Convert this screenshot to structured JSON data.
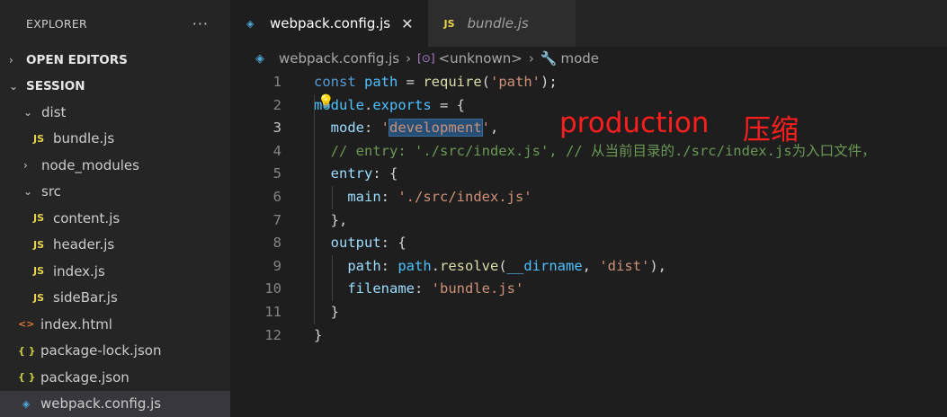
{
  "sidebar": {
    "title": "EXPLORER",
    "more": "···",
    "open_editors": "OPEN EDITORS",
    "session": "SESSION",
    "tree": [
      {
        "label": "dist",
        "kind": "folder-open",
        "depth": 1
      },
      {
        "label": "bundle.js",
        "kind": "js",
        "depth": 2
      },
      {
        "label": "node_modules",
        "kind": "folder-closed",
        "depth": 1
      },
      {
        "label": "src",
        "kind": "folder-open",
        "depth": 1
      },
      {
        "label": "content.js",
        "kind": "js",
        "depth": 2
      },
      {
        "label": "header.js",
        "kind": "js",
        "depth": 2
      },
      {
        "label": "index.js",
        "kind": "js",
        "depth": 2
      },
      {
        "label": "sideBar.js",
        "kind": "js",
        "depth": 2
      },
      {
        "label": "index.html",
        "kind": "html",
        "depth": 1
      },
      {
        "label": "package-lock.json",
        "kind": "json",
        "depth": 1
      },
      {
        "label": "package.json",
        "kind": "json",
        "depth": 1
      },
      {
        "label": "webpack.config.js",
        "kind": "webpack",
        "depth": 1,
        "selected": true
      }
    ]
  },
  "icons": {
    "js": "JS",
    "html": "<>",
    "json": "{ }",
    "webpack": "◈",
    "chevron_right": "›",
    "chevron_down": "⌄"
  },
  "tabs": [
    {
      "label": "webpack.config.js",
      "active": true,
      "close": "✕"
    },
    {
      "label": "bundle.js",
      "active": false
    }
  ],
  "breadcrumb": {
    "file": "webpack.config.js",
    "sep": "›",
    "symbol1": "<unknown>",
    "symbol2": "mode"
  },
  "editor": {
    "lines": [
      {
        "n": "1",
        "tokens": [
          [
            "kw",
            "const "
          ],
          [
            "var",
            "path"
          ],
          [
            "def",
            " = "
          ],
          [
            "fn",
            "require"
          ],
          [
            "def",
            "("
          ],
          [
            "str",
            "'path'"
          ],
          [
            "def",
            ");"
          ]
        ]
      },
      {
        "n": "2",
        "tokens": [
          [
            "var",
            "module"
          ],
          [
            "def",
            "."
          ],
          [
            "var",
            "exports"
          ],
          [
            "def",
            " = {"
          ]
        ]
      },
      {
        "n": "3",
        "tokens": [
          [
            "def",
            "  "
          ],
          [
            "prop",
            "mode"
          ],
          [
            "def",
            ": "
          ],
          [
            "str",
            "'"
          ],
          [
            "strsel",
            "development"
          ],
          [
            "str",
            "'"
          ],
          [
            "def",
            ","
          ]
        ],
        "current": true
      },
      {
        "n": "4",
        "tokens": [
          [
            "def",
            "  "
          ],
          [
            "com",
            "// entry: './src/index.js', // 从当前目录的./src/index.js为入口文件，"
          ]
        ]
      },
      {
        "n": "5",
        "tokens": [
          [
            "def",
            "  "
          ],
          [
            "prop",
            "entry"
          ],
          [
            "def",
            ": {"
          ]
        ]
      },
      {
        "n": "6",
        "tokens": [
          [
            "def",
            "    "
          ],
          [
            "prop",
            "main"
          ],
          [
            "def",
            ": "
          ],
          [
            "str",
            "'./src/index.js'"
          ]
        ]
      },
      {
        "n": "7",
        "tokens": [
          [
            "def",
            "  },"
          ]
        ]
      },
      {
        "n": "8",
        "tokens": [
          [
            "def",
            "  "
          ],
          [
            "prop",
            "output"
          ],
          [
            "def",
            ": {"
          ]
        ]
      },
      {
        "n": "9",
        "tokens": [
          [
            "def",
            "    "
          ],
          [
            "prop",
            "path"
          ],
          [
            "def",
            ": "
          ],
          [
            "var",
            "path"
          ],
          [
            "def",
            "."
          ],
          [
            "fn",
            "resolve"
          ],
          [
            "def",
            "("
          ],
          [
            "var",
            "__dirname"
          ],
          [
            "def",
            ", "
          ],
          [
            "str",
            "'dist'"
          ],
          [
            "def",
            "),"
          ]
        ]
      },
      {
        "n": "10",
        "tokens": [
          [
            "def",
            "    "
          ],
          [
            "prop",
            "filename"
          ],
          [
            "def",
            ": "
          ],
          [
            "str",
            "'bundle.js'"
          ]
        ]
      },
      {
        "n": "11",
        "tokens": [
          [
            "def",
            "  }"
          ]
        ]
      },
      {
        "n": "12",
        "tokens": [
          [
            "def",
            "}"
          ]
        ]
      }
    ]
  },
  "annotations": {
    "word1": "production",
    "word2": "压缩"
  },
  "colors": {
    "annotation": "#ff1e1e",
    "string": "#ce9178",
    "keyword": "#569cd6",
    "comment": "#6a9955"
  }
}
